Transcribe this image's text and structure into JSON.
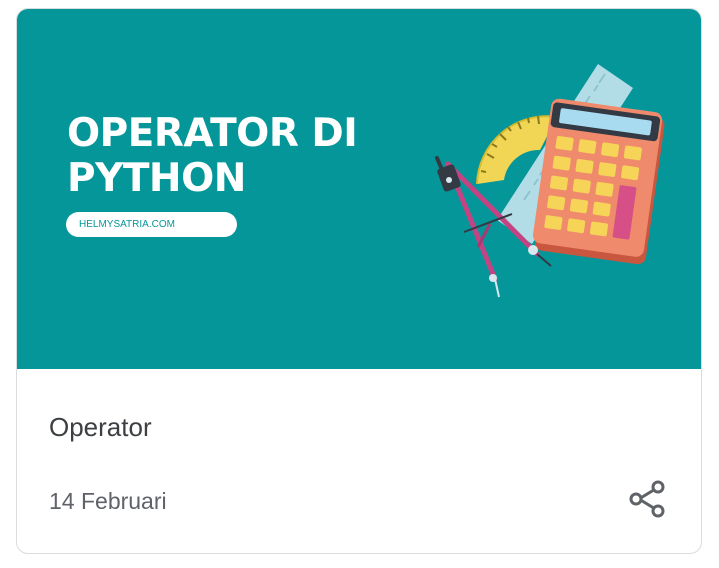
{
  "card": {
    "banner": {
      "title_line1": "OPERATOR DI",
      "title_line2": "PYTHON",
      "site": "HELMYSATRIA.COM",
      "illustration": "calculator-compass-ruler-protractor-illustration"
    },
    "title": "Operator",
    "date": "14 Februari",
    "share_icon": "share-icon"
  },
  "colors": {
    "banner_bg": "#05969a",
    "title_text": "#3c4043",
    "date_text": "#5f6368",
    "icon": "#5f6368"
  }
}
